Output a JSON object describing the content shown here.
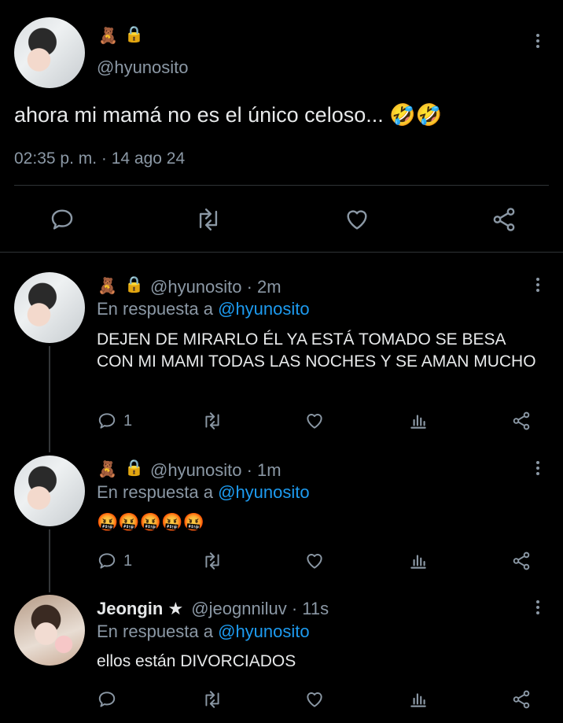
{
  "main_tweet": {
    "badges": [
      "🧸",
      "🔒"
    ],
    "handle": "@hyunosito",
    "text": "ahora mi mamá no es el único celoso... 🤣🤣",
    "timestamp": "02:35 p. m. · 14 ago 24"
  },
  "replies": [
    {
      "badges": [
        "🧸",
        "🔒"
      ],
      "name": "",
      "handle_time": "@hyunosito · 2m",
      "reply_prefix": "En respuesta a",
      "reply_to": "@hyunosito",
      "text": "DEJEN DE MIRARLO ÉL YA ESTÁ TOMADO SE BESA CON MI MAMI TODAS LAS NOCHES Y SE AMAN MUCHO",
      "reply_count": "1"
    },
    {
      "badges": [
        "🧸",
        "🔒"
      ],
      "name": "",
      "handle_time": "@hyunosito · 1m",
      "reply_prefix": "En respuesta a",
      "reply_to": "@hyunosito",
      "text": "🤬🤬🤬🤬🤬",
      "reply_count": "1"
    },
    {
      "name": "Jeongin ★",
      "handle_time": "@jeognniluv · 11s",
      "reply_prefix": "En respuesta a",
      "reply_to": "@hyunosito",
      "text": "ellos están DIVORCIADOS",
      "reply_count": ""
    }
  ],
  "icons": {
    "reply": "reply-icon",
    "retweet": "retweet-icon",
    "like": "heart-icon",
    "views": "analytics-icon",
    "share": "share-icon",
    "menu": "more-icon"
  },
  "colors": {
    "background": "#000000",
    "text": "#e7e9ea",
    "secondary": "#8b98a5",
    "link": "#1d9bf0",
    "divider": "#2f3336"
  }
}
